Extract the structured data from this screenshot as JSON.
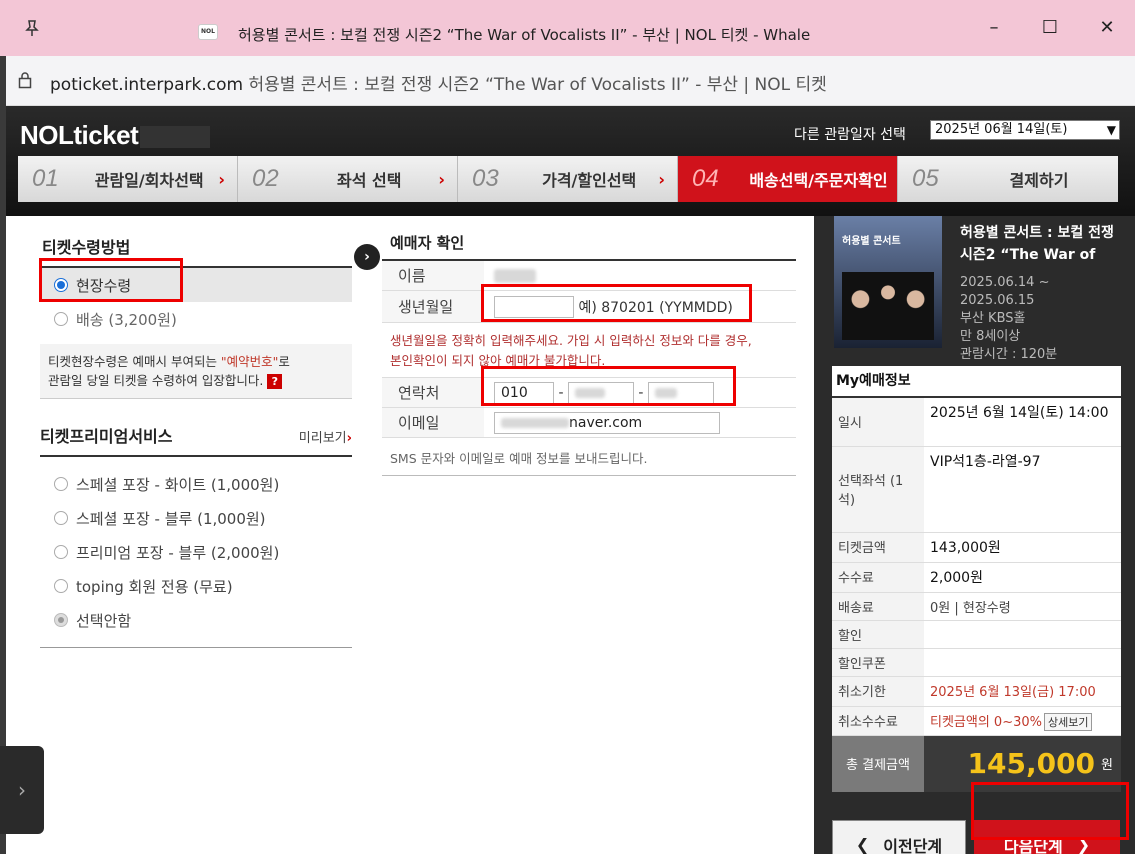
{
  "window": {
    "title": "허용별 콘서트 : 보컬 전쟁 시즌2 “The War of Vocalists II” - 부산 | NOL 티켓 - Whale",
    "favicon_text": "NOL",
    "url_domain": "poticket.interpark.com",
    "url_rest": " 허용별 콘서트 : 보컬 전쟁 시즌2 “The War of Vocalists II” - 부산 | NOL 티켓"
  },
  "header": {
    "logo": "NOLticket",
    "date_label": "다른 관람일자 선택",
    "date_selected": "2025년 06월 14일(토)"
  },
  "steps": [
    {
      "num": "01",
      "label": "관람일/회차선택"
    },
    {
      "num": "02",
      "label": "좌석 선택"
    },
    {
      "num": "03",
      "label": "가격/할인선택"
    },
    {
      "num": "04",
      "label": "배송선택/주문자확인"
    },
    {
      "num": "05",
      "label": "결제하기"
    }
  ],
  "receive": {
    "title": "티켓수령방법",
    "options": [
      "현장수령",
      "배송 (3,200원)"
    ],
    "notice_a": "티켓현장수령은 예매시 부여되는 ",
    "notice_red": "\"예약번호\"",
    "notice_b": "로",
    "notice_c": "관람일 당일 티켓을 수령하여 입장합니다.",
    "notice_q": "?"
  },
  "premium": {
    "title": "티켓프리미엄서비스",
    "more": "미리보기",
    "more_arrow": "›",
    "options": [
      "스페셜 포장 - 화이트 (1,000원)",
      "스페셜 포장 - 블루 (1,000원)",
      "프리미엄 포장 - 블루 (2,000원)",
      "toping 회원 전용 (무료)",
      "선택안함"
    ]
  },
  "booker": {
    "title": "예매자 확인",
    "name_label": "이름",
    "birth_label": "생년월일",
    "birth_hint": "예) 870201 (YYMMDD)",
    "warning_1": "생년월일을 정확히 입력해주세요. 가입 시 입력하신 정보와 다를 경우,",
    "warning_2": "본인확인이 되지 않아 예매가 불가합니다.",
    "phone_label": "연락처",
    "phone_1": "010",
    "dash": "-",
    "email_label": "이메일",
    "email_visible": "naver.com",
    "sms_note": "SMS 문자와 이메일로 예매 정보를 보내드립니다."
  },
  "concert": {
    "title": "허용별 콘서트 : 보컬 전쟁 시즌2 “The War of",
    "poster_title": "허용별 콘서트",
    "period_1": "2025.06.14 ~",
    "period_2": "2025.06.15",
    "venue": "부산 KBS홀",
    "age": "만 8세이상",
    "runtime": "관람시간 : 120분"
  },
  "my": {
    "title": "My예매정보",
    "rows": [
      {
        "k": "일시",
        "v": "2025년 6월 14일(토) 14:00"
      },
      {
        "k": "선택좌석 (1석)",
        "v": "VIP석1층-라열-97"
      },
      {
        "k": "티켓금액",
        "v": "143,000원"
      },
      {
        "k": "수수료",
        "v": "2,000원"
      },
      {
        "k": "배송료",
        "v": "0원 | 현장수령"
      },
      {
        "k": "할인",
        "v": ""
      },
      {
        "k": "할인쿠폰",
        "v": ""
      },
      {
        "k": "취소기한",
        "v": "2025년 6월 13일(금) 17:00"
      },
      {
        "k": "취소수수료",
        "v": "티켓금액의 0~30%"
      }
    ],
    "detail_btn": "상세보기",
    "total_label": "총 결제금액",
    "total_value": "145,000",
    "total_unit": "원",
    "prev_btn": "이전단계",
    "next_btn": "다음단계"
  }
}
